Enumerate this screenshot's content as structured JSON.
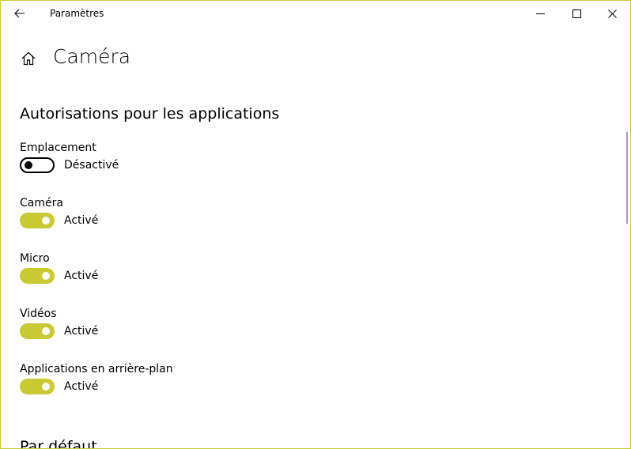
{
  "window": {
    "title": "Paramètres",
    "accent_color": "#c9c936",
    "controls": {
      "back_icon": "arrow-left-icon",
      "minimize_icon": "minimize-icon",
      "maximize_icon": "maximize-icon",
      "close_icon": "close-icon"
    }
  },
  "header": {
    "home_icon": "home-icon",
    "title": "Caméra"
  },
  "sections": {
    "permissions": {
      "title": "Autorisations pour les applications",
      "items": [
        {
          "label": "Emplacement",
          "state": "Désactivé",
          "on": false
        },
        {
          "label": "Caméra",
          "state": "Activé",
          "on": true
        },
        {
          "label": "Micro",
          "state": "Activé",
          "on": true
        },
        {
          "label": "Vidéos",
          "state": "Activé",
          "on": true
        },
        {
          "label": "Applications en arrière-plan",
          "state": "Activé",
          "on": true
        }
      ]
    },
    "defaults": {
      "title": "Par défaut"
    }
  }
}
